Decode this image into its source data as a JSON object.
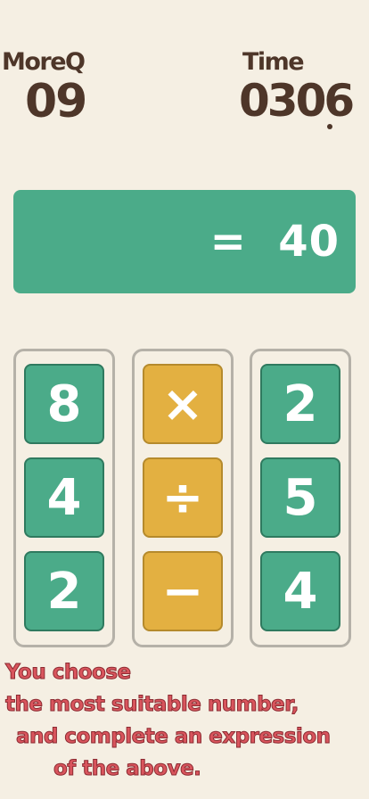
{
  "hud": {
    "moreq_label": "MoreQ",
    "moreq_value": "09",
    "time_label": "Time",
    "time_value": "0306"
  },
  "expression": {
    "text": "=  40"
  },
  "columns": {
    "left": [
      "8",
      "4",
      "2"
    ],
    "middle": [
      "×",
      "÷",
      "−"
    ],
    "right": [
      "2",
      "5",
      "4"
    ]
  },
  "instructions": {
    "line1": "You choose",
    "line2": "the most suitable number,",
    "line3": "and complete an expression",
    "line4": "of the above."
  },
  "colors": {
    "background": "#f5efe3",
    "number_tile": "#4bab89",
    "operator_tile": "#e3b041",
    "text_dark": "#4e3629",
    "instruction_text": "#d9555d"
  }
}
